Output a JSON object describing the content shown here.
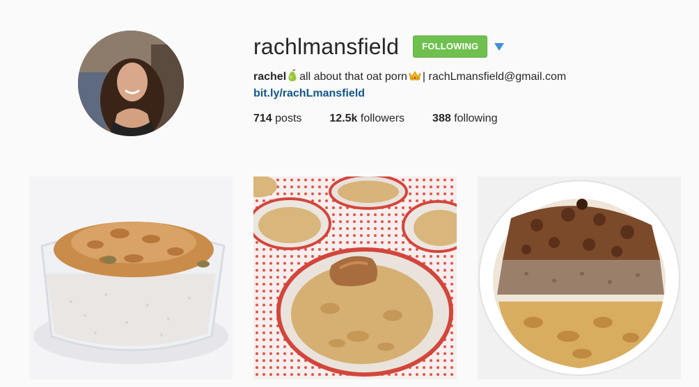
{
  "profile": {
    "username": "rachlmansfield",
    "follow_button_label": "FOLLOWING",
    "bio": {
      "name": "rachel",
      "pear_emoji": "pear-icon",
      "text_before_crown": "all about that oat porn",
      "crown_emoji": "crown-icon",
      "text_after_crown": "| rachLmansfield@gmail.com",
      "link": "bit.ly/rachLmansfield"
    },
    "stats": {
      "posts_count": "714",
      "posts_label": "posts",
      "followers_count": "12.5k",
      "followers_label": "followers",
      "following_count": "388",
      "following_label": "following"
    }
  },
  "colors": {
    "follow_button": "#70c050",
    "link": "#125688",
    "caret": "#3f8fd8",
    "background": "#fafafa"
  },
  "posts": [
    {
      "subject": "granola over chia pudding in glass bowl"
    },
    {
      "subject": "baked oat cups in red dotted muffin tin with almond butter"
    },
    {
      "subject": "bowl of oats topped with granola and crumble"
    }
  ]
}
